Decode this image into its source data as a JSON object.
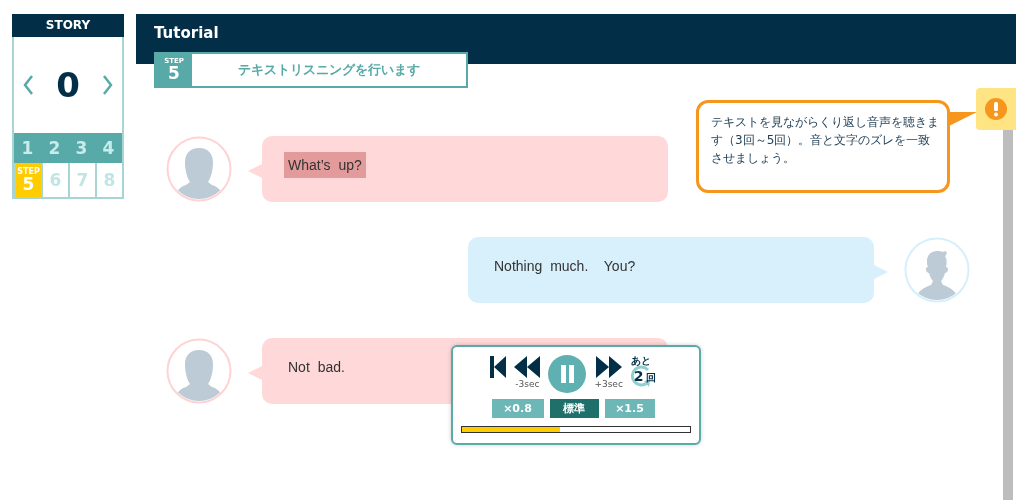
{
  "sidebar": {
    "title": "STORY",
    "counter": "0",
    "steps": [
      {
        "label": "1",
        "completed": true,
        "selected": false
      },
      {
        "label": "2",
        "completed": true,
        "selected": false
      },
      {
        "label": "3",
        "completed": true,
        "selected": false
      },
      {
        "label": "4",
        "completed": true,
        "selected": false
      },
      {
        "label": "5",
        "completed": false,
        "selected": true,
        "tag": "STEP"
      },
      {
        "label": "6",
        "completed": false,
        "selected": false
      },
      {
        "label": "7",
        "completed": false,
        "selected": false
      },
      {
        "label": "8",
        "completed": false,
        "selected": false
      }
    ]
  },
  "header": {
    "title": "Tutorial"
  },
  "step": {
    "tag": "STEP",
    "number": "5",
    "text": "テキストリスニングを行います"
  },
  "tip": {
    "text": "テキストを見ながらくり返し音声を聴きます（3回～5回）。音と文字のズレを一致させましょう。"
  },
  "messages": [
    {
      "kind": "partner",
      "text": "What’s up?",
      "highlighted": true
    },
    {
      "kind": "user",
      "text": "Nothing much.  You?",
      "highlighted": false
    },
    {
      "kind": "partner",
      "text": "Not bad.",
      "highlighted": false
    }
  ],
  "player": {
    "back_label": "-3sec",
    "forward_label": "+3sec",
    "remaining_prefix": "あと",
    "remaining_count": "2",
    "remaining_unit": "回",
    "playing": true,
    "speeds": [
      {
        "label": "×0.8",
        "selected": false
      },
      {
        "label": "標準",
        "selected": true
      },
      {
        "label": "×1.5",
        "selected": false
      }
    ],
    "progress": {
      "level": 0.43
    }
  }
}
